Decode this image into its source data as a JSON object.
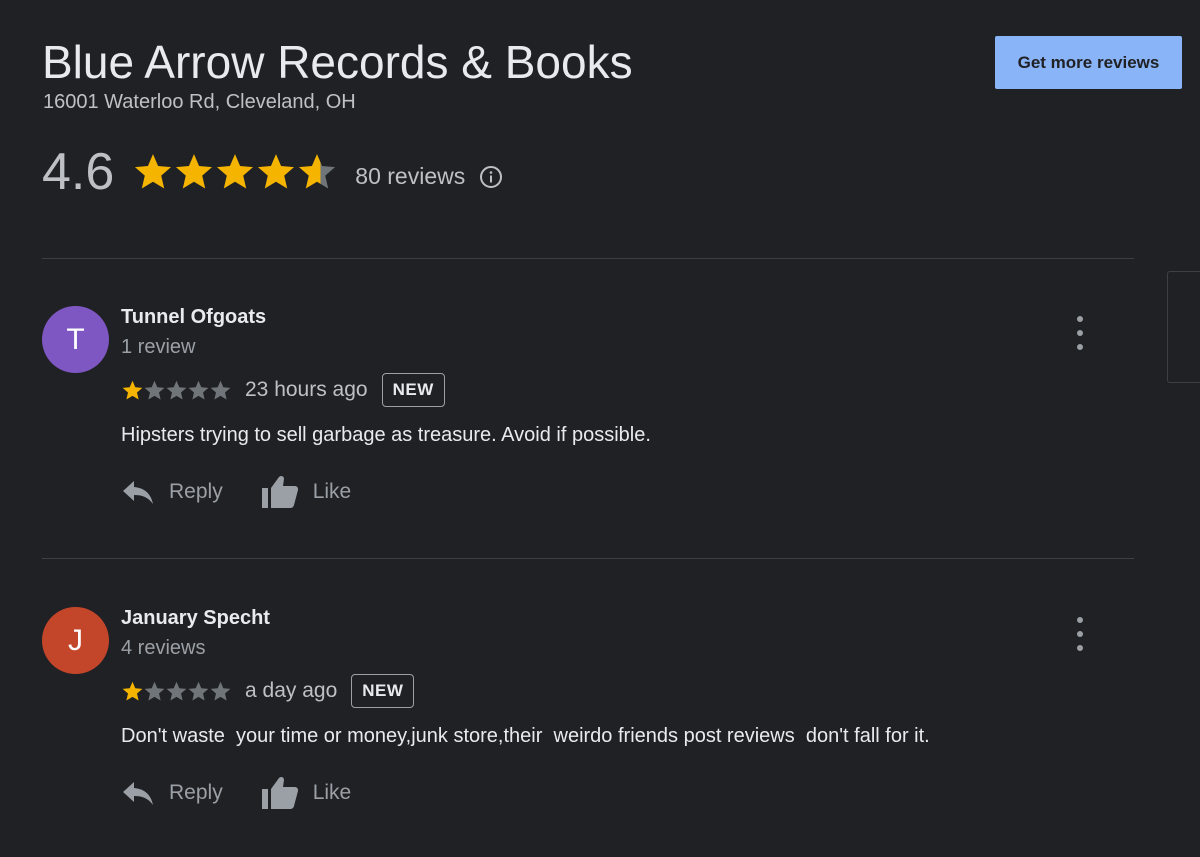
{
  "business": {
    "name": "Blue Arrow Records & Books",
    "address": "16001 Waterloo Rd, Cleveland, OH",
    "rating": "4.6",
    "rating_value": 4.6,
    "reviews_label": "80 reviews"
  },
  "header": {
    "get_more_reviews_label": "Get more reviews"
  },
  "colors": {
    "star_filled": "#f4b400",
    "star_empty": "#70757a",
    "button_bg": "#8ab4f8"
  },
  "reviews": [
    {
      "initial": "T",
      "avatar_color": "#7e57c2",
      "name": "Tunnel Ofgoats",
      "count": "1 review",
      "stars": 1,
      "time": "23 hours ago",
      "badge": "NEW",
      "text": "Hipsters trying to sell garbage as treasure. Avoid if possible.",
      "reply_label": "Reply",
      "like_label": "Like"
    },
    {
      "initial": "J",
      "avatar_color": "#c4462a",
      "name": "January Specht",
      "count": "4 reviews",
      "stars": 1,
      "time": "a day ago",
      "badge": "NEW",
      "text": "Don't waste  your time or money,junk store,their  weirdo friends post reviews  don't fall for it.",
      "reply_label": "Reply",
      "like_label": "Like"
    }
  ]
}
